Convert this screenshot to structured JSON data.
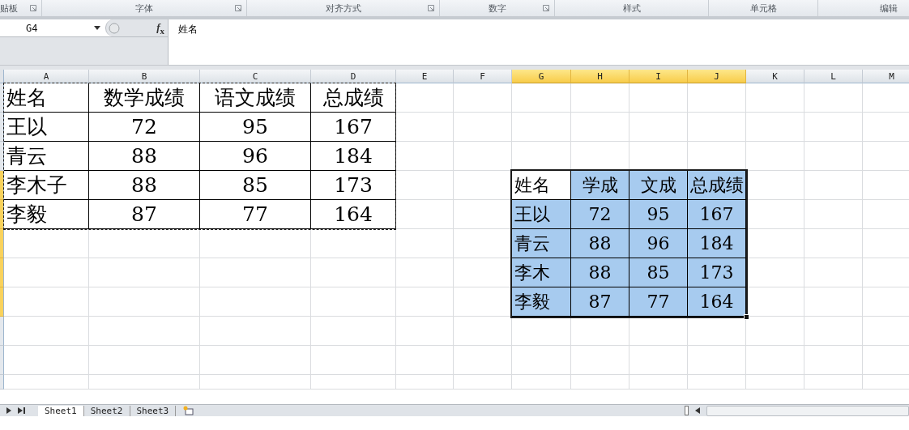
{
  "ribbon_groups": [
    {
      "label": "贴板",
      "launcher": true
    },
    {
      "label": "字体",
      "launcher": true
    },
    {
      "label": "对齐方式",
      "launcher": true
    },
    {
      "label": "数字",
      "launcher": true
    },
    {
      "label": "样式",
      "launcher": false
    },
    {
      "label": "单元格",
      "launcher": false
    },
    {
      "label": "编辑",
      "launcher": false
    }
  ],
  "name_box": {
    "value": "G4"
  },
  "formula_bar": {
    "function_button": "*f*$_{x}$",
    "value": "姓名"
  },
  "columns": [
    {
      "label": "A",
      "selected": false
    },
    {
      "label": "B",
      "selected": false
    },
    {
      "label": "C",
      "selected": false
    },
    {
      "label": "D",
      "selected": false
    },
    {
      "label": "E",
      "selected": false
    },
    {
      "label": "F",
      "selected": false
    },
    {
      "label": "G",
      "selected": true
    },
    {
      "label": "H",
      "selected": true
    },
    {
      "label": "I",
      "selected": true
    },
    {
      "label": "J",
      "selected": true
    },
    {
      "label": "K",
      "selected": false
    },
    {
      "label": "L",
      "selected": false
    },
    {
      "label": "M",
      "selected": false
    }
  ],
  "row_headers": [
    {
      "selected": false
    },
    {
      "selected": false
    },
    {
      "selected": false
    },
    {
      "selected": true
    },
    {
      "selected": true
    },
    {
      "selected": true
    },
    {
      "selected": true
    },
    {
      "selected": true
    },
    {
      "selected": false
    },
    {
      "selected": false
    },
    {
      "selected": false
    }
  ],
  "copied_table": {
    "marquee": true,
    "rows": [
      [
        "姓名",
        "数学成绩",
        "语文成绩",
        "总成绩"
      ],
      [
        "王以",
        "72",
        "95",
        "167"
      ],
      [
        "青云",
        "88",
        "96",
        "184"
      ],
      [
        "李木子",
        "88",
        "85",
        "173"
      ],
      [
        "李毅",
        "87",
        "77",
        "164"
      ]
    ]
  },
  "pasted_table": {
    "highlighted": true,
    "rows": [
      [
        "姓名",
        "学成",
        "文成",
        "总成绩"
      ],
      [
        "王以",
        "72",
        "95",
        "167"
      ],
      [
        "青云",
        "88",
        "96",
        "184"
      ],
      [
        "李木",
        "88",
        "85",
        "173"
      ],
      [
        "李毅",
        "87",
        "77",
        "164"
      ]
    ]
  },
  "sheet_tabs": [
    {
      "label": "Sheet1",
      "selected": true
    },
    {
      "label": "Sheet2",
      "selected": false
    },
    {
      "label": "Sheet3",
      "selected": false
    }
  ]
}
